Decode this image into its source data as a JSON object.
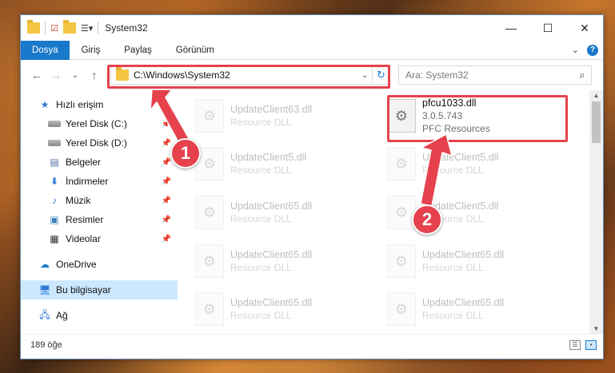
{
  "window": {
    "title": "System32",
    "controls": {
      "minimize": "—",
      "maximize": "☐",
      "close": "✕"
    }
  },
  "ribbon": {
    "tabs": [
      {
        "label": "Dosya",
        "active": true
      },
      {
        "label": "Giriş",
        "active": false
      },
      {
        "label": "Paylaş",
        "active": false
      },
      {
        "label": "Görünüm",
        "active": false
      }
    ],
    "help": "?",
    "expand": "⌄"
  },
  "nav": {
    "back": "←",
    "forward": "→",
    "recent": "⌄",
    "up": "↑",
    "address": "C:\\Windows\\System32",
    "address_dropdown": "⌄",
    "refresh": "↻",
    "search_placeholder": "Ara: System32",
    "search_icon": "⌕"
  },
  "sidebar": {
    "quick_access": {
      "label": "Hızlı erişim",
      "icon": "star-icon"
    },
    "items": [
      {
        "label": "Yerel Disk (C:)",
        "icon": "drive-icon",
        "pinned": true
      },
      {
        "label": "Yerel Disk (D:)",
        "icon": "drive-icon",
        "pinned": true
      },
      {
        "label": "Belgeler",
        "icon": "document-icon",
        "pinned": true
      },
      {
        "label": "İndirmeler",
        "icon": "download-icon",
        "pinned": true
      },
      {
        "label": "Müzik",
        "icon": "music-icon",
        "pinned": true
      },
      {
        "label": "Resimler",
        "icon": "pictures-icon",
        "pinned": true
      },
      {
        "label": "Videolar",
        "icon": "video-icon",
        "pinned": true
      }
    ],
    "onedrive": "OneDrive",
    "this_pc": "Bu bilgisayar",
    "network": "Ağ"
  },
  "files": [
    {
      "name": "UpdateClient63.dll",
      "desc": "Resource DLL",
      "highlight": false
    },
    {
      "name": "pfcu1033.dll",
      "version": "3.0.5.743",
      "desc": "PFC Resources",
      "highlight": true
    },
    {
      "name": "UpdateClient5.dll",
      "desc": "Resource DLL",
      "highlight": false
    },
    {
      "name": "UpdateClient5.dll",
      "desc": "Resource DLL",
      "highlight": false
    },
    {
      "name": "UpdateClient65.dll",
      "desc": "Resource DLL",
      "highlight": false
    },
    {
      "name": "UpdateClient5.dll",
      "desc": "Resource DLL",
      "highlight": false
    },
    {
      "name": "UpdateClient65.dll",
      "desc": "Resource DLL",
      "highlight": false
    },
    {
      "name": "UpdateClient65.dll",
      "desc": "Resource DLL",
      "highlight": false
    },
    {
      "name": "UpdateClient65.dll",
      "desc": "Resource DLL",
      "highlight": false
    },
    {
      "name": "UpdateClient65.dll",
      "desc": "Resource DLL",
      "highlight": false
    }
  ],
  "status": {
    "count": "189 öğe"
  },
  "annotations": {
    "badge1": "1",
    "badge2": "2",
    "color": "#e5424d"
  }
}
